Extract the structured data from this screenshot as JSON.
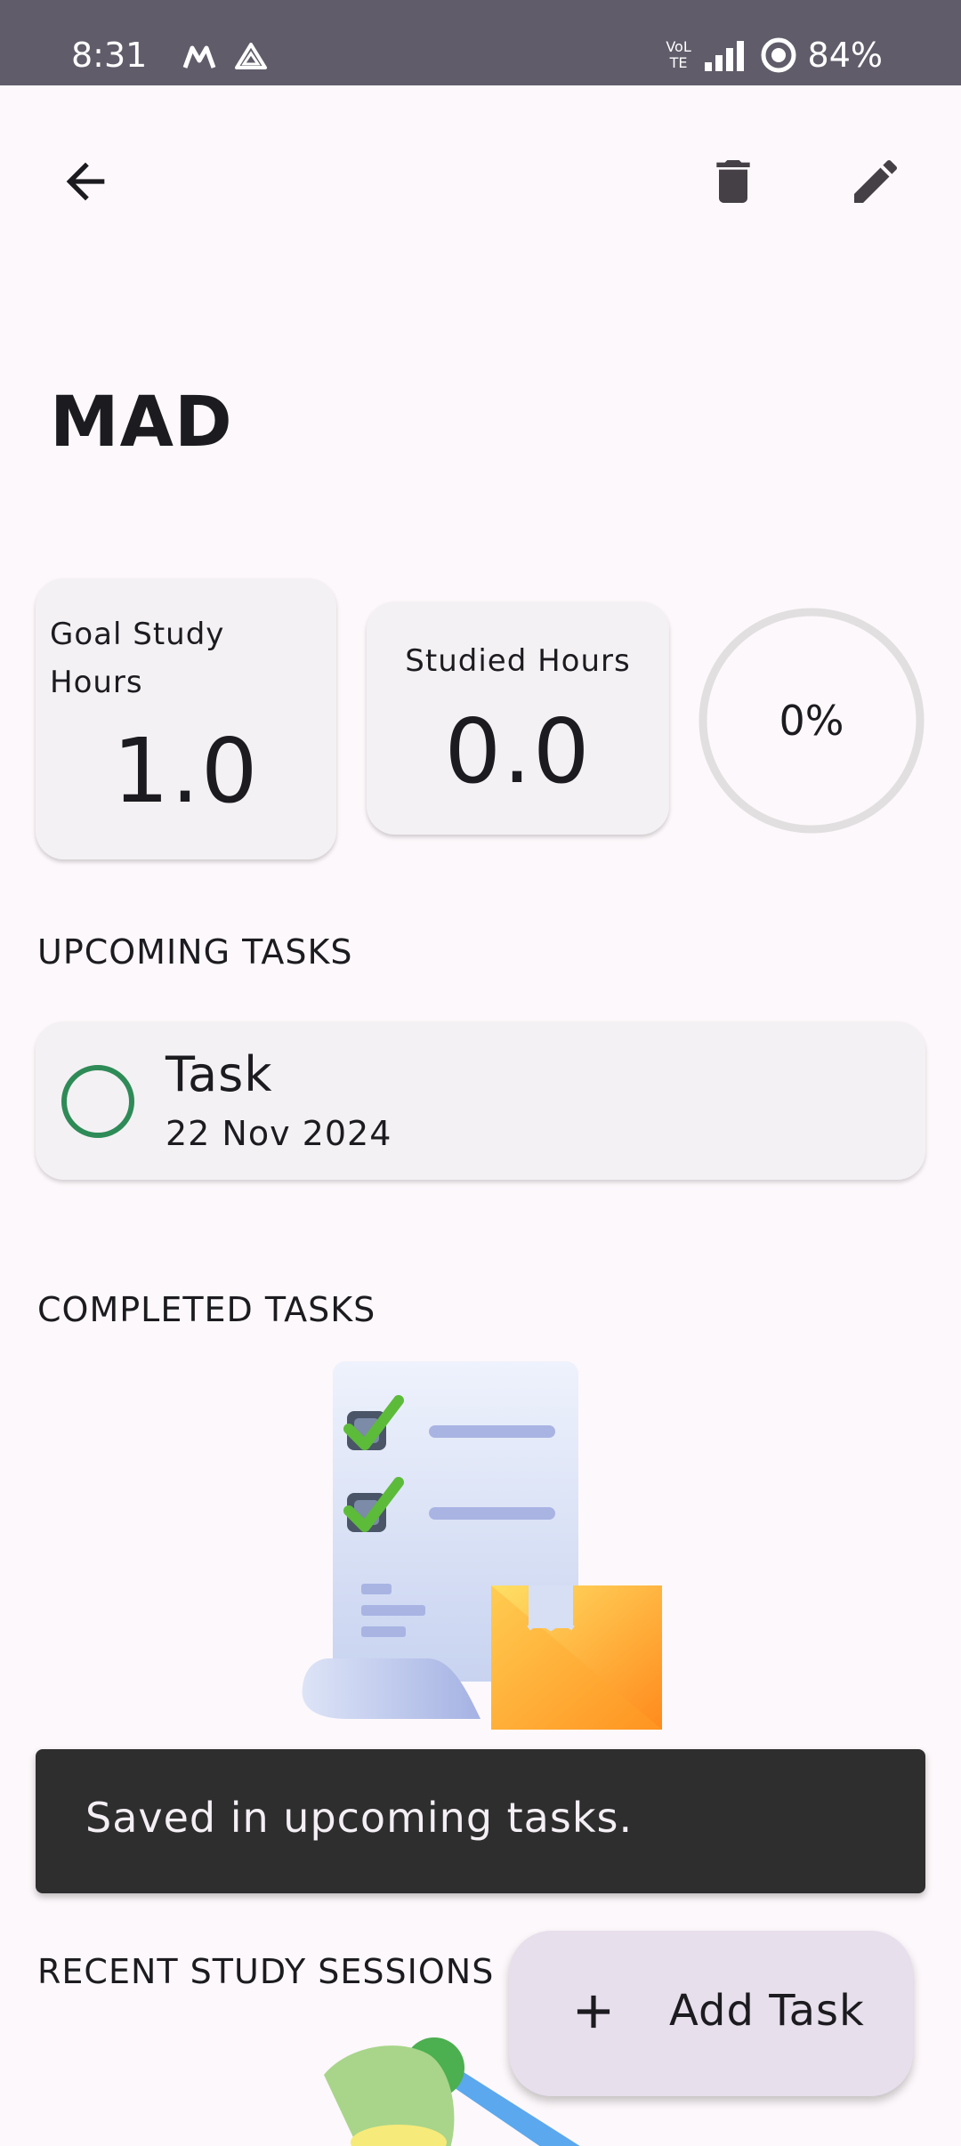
{
  "status_bar": {
    "time": "8:31",
    "battery": "84%",
    "network": "VoLTE"
  },
  "toolbar": {
    "back_icon": "arrow-back-icon",
    "delete_icon": "trash-icon",
    "edit_icon": "pencil-icon"
  },
  "subject": {
    "title": "MAD"
  },
  "stats": {
    "goal_label": "Goal Study Hours",
    "goal_value": "1.0",
    "studied_label": "Studied Hours",
    "studied_value": "0.0",
    "progress_label": "0%",
    "progress_fraction": 0
  },
  "sections": {
    "upcoming": "UPCOMING TASKS",
    "completed": "COMPLETED TASKS",
    "recent_sessions": "RECENT STUDY SESSIONS"
  },
  "upcoming_tasks": [
    {
      "title": "Task",
      "date": "22 Nov 2024"
    }
  ],
  "snackbar": {
    "message": "Saved in upcoming tasks."
  },
  "fab": {
    "label": "Add Task",
    "icon": "plus-icon"
  },
  "colors": {
    "background": "#FDF8FB",
    "status_bar": "#615C6A",
    "card": "#F4F1F4",
    "task_check": "#2E8B57",
    "snackbar": "#2E2E2E",
    "fab": "#E7DFEC"
  }
}
